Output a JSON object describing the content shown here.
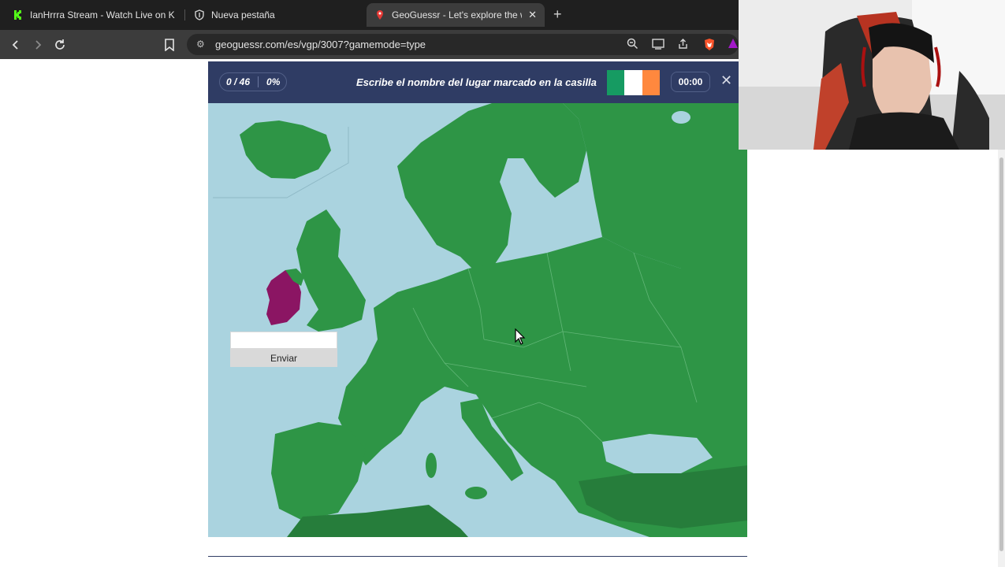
{
  "browser": {
    "tabs": [
      {
        "title": "IanHrrra Stream - Watch Live on Kick",
        "icon": "kick-icon",
        "active": false
      },
      {
        "title": "Nueva pestaña",
        "icon": "shield-icon",
        "active": false
      },
      {
        "title": "GeoGuessr - Let's explore the wo",
        "icon": "location-pin-icon",
        "active": true
      }
    ],
    "url": "geoguessr.com/es/vgp/3007?gamemode=type"
  },
  "game": {
    "progress": "0 / 46",
    "percent": "0%",
    "prompt": "Escribe el nombre del lugar marcado en la casilla",
    "timer": "00:00",
    "flag_colors": [
      "#169b62",
      "#ffffff",
      "#ff883e"
    ],
    "highlight_color": "#8b1563",
    "land_color": "#2e9546",
    "water_color": "#aad3df"
  },
  "answer": {
    "input_value": "",
    "submit_label": "Enviar"
  }
}
